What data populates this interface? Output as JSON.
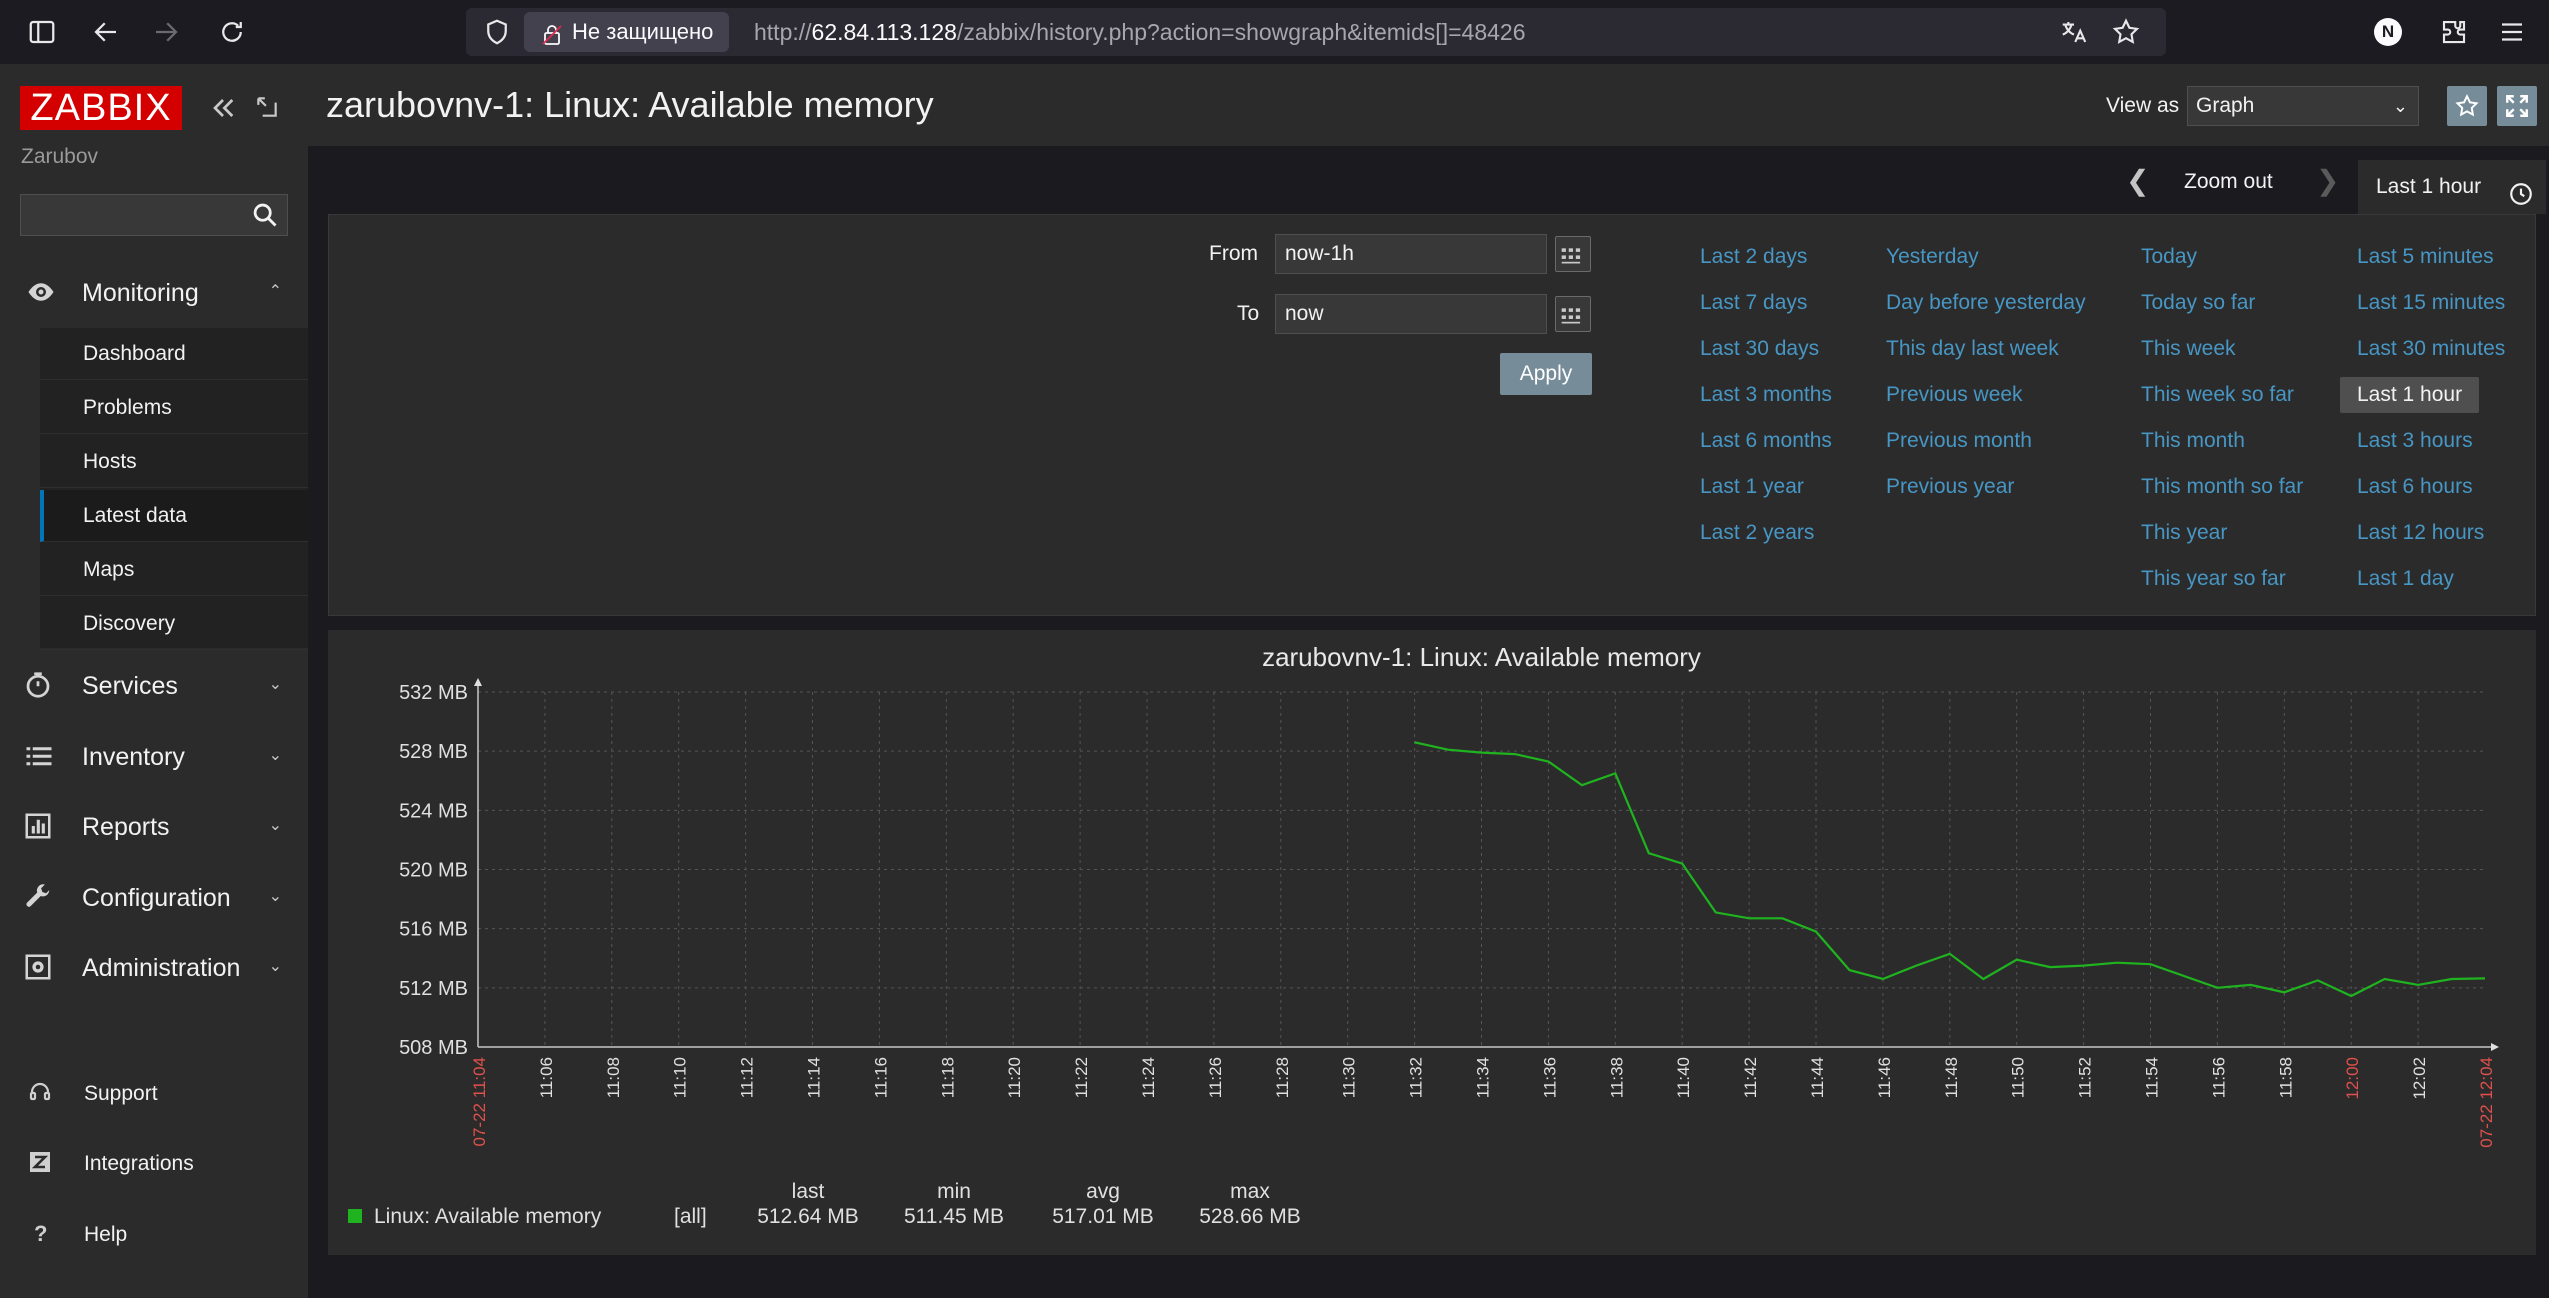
{
  "browser": {
    "security_label": "Не защищено",
    "url_scheme": "http://",
    "url_host": "62.84.113.128",
    "url_path": "/zabbix/history.php?action=showgraph&itemids[]=48426",
    "profile_initial": "N"
  },
  "sidebar": {
    "logo": "ZABBIX",
    "user": "Zarubov",
    "search_placeholder": "",
    "monitoring": {
      "label": "Monitoring",
      "items": [
        "Dashboard",
        "Problems",
        "Hosts",
        "Latest data",
        "Maps",
        "Discovery"
      ],
      "active": "Latest data"
    },
    "sections": [
      "Services",
      "Inventory",
      "Reports",
      "Configuration",
      "Administration"
    ],
    "footer": [
      "Support",
      "Integrations",
      "Help"
    ]
  },
  "header": {
    "title": "zarubovnv-1: Linux: Available memory",
    "view_as_label": "View as",
    "view_as_value": "Graph"
  },
  "timenav": {
    "zoom_out": "Zoom out",
    "current": "Last 1 hour"
  },
  "filter": {
    "from_label": "From",
    "from_value": "now-1h",
    "to_label": "To",
    "to_value": "now",
    "apply_label": "Apply",
    "quick_ranges": [
      [
        "Last 2 days",
        "Last 7 days",
        "Last 30 days",
        "Last 3 months",
        "Last 6 months",
        "Last 1 year",
        "Last 2 years"
      ],
      [
        "Yesterday",
        "Day before yesterday",
        "This day last week",
        "Previous week",
        "Previous month",
        "Previous year"
      ],
      [
        "Today",
        "Today so far",
        "This week",
        "This week so far",
        "This month",
        "This month so far",
        "This year",
        "This year so far"
      ],
      [
        "Last 5 minutes",
        "Last 15 minutes",
        "Last 30 minutes",
        "Last 1 hour",
        "Last 3 hours",
        "Last 6 hours",
        "Last 12 hours",
        "Last 1 day"
      ]
    ],
    "selected": "Last 1 hour"
  },
  "chart_data": {
    "type": "line",
    "title": "zarubovnv-1: Linux: Available memory",
    "y_unit": "MB",
    "ylim": [
      508,
      532
    ],
    "y_ticks": [
      "532 MB",
      "528 MB",
      "524 MB",
      "520 MB",
      "516 MB",
      "512 MB",
      "508 MB"
    ],
    "x_start_label": "07-22 11:04",
    "x_end_label": "07-22 12:04",
    "x_ticks": [
      "11:06",
      "11:08",
      "11:10",
      "11:12",
      "11:14",
      "11:16",
      "11:18",
      "11:20",
      "11:22",
      "11:24",
      "11:26",
      "11:28",
      "11:30",
      "11:32",
      "11:34",
      "11:36",
      "11:38",
      "11:40",
      "11:42",
      "11:44",
      "11:46",
      "11:48",
      "11:50",
      "11:52",
      "11:54",
      "11:56",
      "11:58",
      "12:00",
      "12:02"
    ],
    "x_highlight_tick": "12:00",
    "grid": true,
    "series": [
      {
        "name": "Linux: Available memory",
        "color": "#1fb41f",
        "x": [
          "11:32",
          "11:33",
          "11:34",
          "11:35",
          "11:36",
          "11:37",
          "11:38",
          "11:39",
          "11:40",
          "11:41",
          "11:42",
          "11:43",
          "11:44",
          "11:45",
          "11:46",
          "11:47",
          "11:48",
          "11:49",
          "11:50",
          "11:51",
          "11:52",
          "11:53",
          "11:54",
          "11:55",
          "11:56",
          "11:57",
          "11:58",
          "11:59",
          "12:00",
          "12:01",
          "12:02",
          "12:03",
          "12:04"
        ],
        "values": [
          528.6,
          528.1,
          527.9,
          527.8,
          527.3,
          525.7,
          526.5,
          521.1,
          520.4,
          517.1,
          516.7,
          516.7,
          515.8,
          513.2,
          512.6,
          513.5,
          514.3,
          512.6,
          513.9,
          513.4,
          513.5,
          513.7,
          513.6,
          512.8,
          512.0,
          512.2,
          511.7,
          512.5,
          511.45,
          512.6,
          512.2,
          512.6,
          512.64
        ]
      }
    ],
    "legend": {
      "position": "bottom-left",
      "entry": "Linux: Available memory",
      "func": "[all]",
      "headers": [
        "last",
        "min",
        "avg",
        "max"
      ],
      "values": [
        "512.64 MB",
        "511.45 MB",
        "517.01 MB",
        "528.66 MB"
      ]
    }
  }
}
